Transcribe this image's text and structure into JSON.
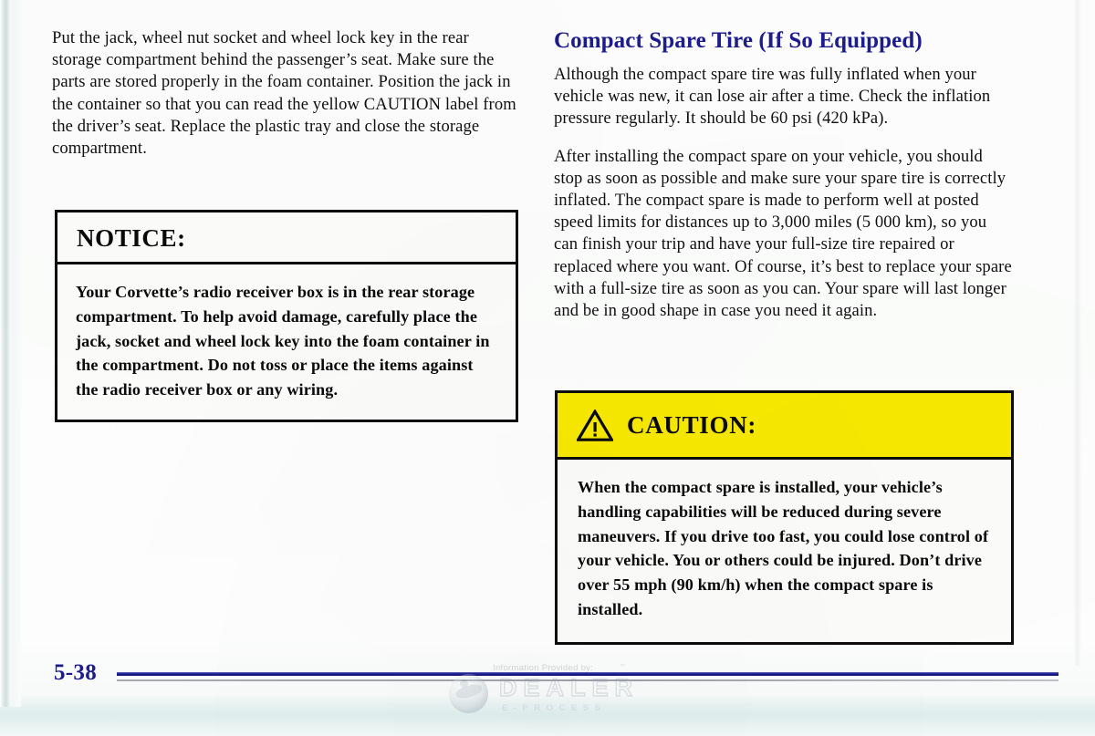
{
  "page": {
    "number": "5-38",
    "background_color": "#fbfcfb",
    "heading_color": "#1c1c8e"
  },
  "left_column": {
    "paragraphs": [
      "Put the jack, wheel nut socket and wheel lock key in the rear storage compartment behind the passenger’s seat. Make sure the parts are stored properly in the foam container. Position the jack in the container so that you can read the yellow CAUTION label from the driver’s seat. Replace the plastic tray and close the storage compartment."
    ],
    "notice_box": {
      "title": "NOTICE:",
      "body": "Your Corvette’s radio receiver box is in the rear storage compartment. To help avoid damage, carefully place the jack, socket and wheel lock key into the foam container in the compartment. Do not toss or place the items against the radio receiver box or any wiring.",
      "border_color": "#0d0d0d"
    }
  },
  "right_column": {
    "heading": "Compact Spare Tire (If So Equipped)",
    "paragraphs": [
      "Although the compact spare tire was fully inflated when your vehicle was new, it can lose air after a time. Check the inflation pressure regularly. It should be 60 psi (420 kPa).",
      "After installing the compact spare on your vehicle, you should stop as soon as possible and make sure your spare tire is correctly inflated. The compact spare is made to perform well at posted speed limits for distances up to 3,000 miles (5 000 km), so you can finish your trip and have your full-size tire repaired or replaced where you want. Of course, it’s best to replace your spare with a full-size tire as soon as you can. Your spare will last longer and be in good shape in case you need it again."
    ],
    "caution_box": {
      "icon": "warning-triangle-icon",
      "title": "CAUTION:",
      "header_color": "#f7e800",
      "body": "When the compact spare is installed, your vehicle’s handling capabilities will be reduced during severe maneuvers. If you drive too fast, you could lose control of your vehicle. You or others could be injured. Don’t drive over 55 mph (90 km/h) when the compact spare is installed."
    }
  },
  "watermark": {
    "provided_by": "Information Provided by:",
    "brand": "DEALER",
    "subbrand": "E-PROCESS",
    "trademark": "™",
    "logo": "globe-icon"
  }
}
